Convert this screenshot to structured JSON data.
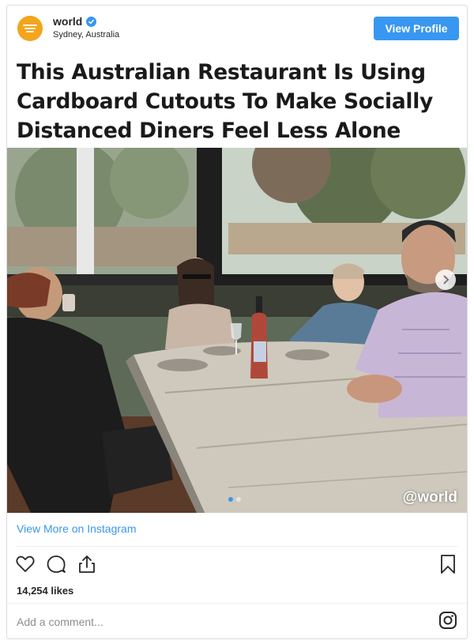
{
  "header": {
    "username": "world",
    "location": "Sydney, Australia",
    "view_profile_label": "View Profile",
    "avatar_icon": "brand-logo-icon",
    "verified_icon": "verified-badge-icon"
  },
  "post": {
    "headline": "This Australian Restaurant Is Using Cardboard Cutouts To Make Socially Distanced Diners Feel Less Alone",
    "watermark": "@world",
    "carousel": {
      "count": 2,
      "active": 1
    }
  },
  "footer": {
    "view_more_label": "View More on Instagram",
    "likes": "14,254 likes",
    "comment_placeholder": "Add a comment...",
    "icons": [
      "heart-icon",
      "comment-icon",
      "share-icon",
      "bookmark-icon",
      "instagram-icon"
    ]
  },
  "colors": {
    "accent": "#3897f0",
    "avatar": "#f2a51d",
    "text": "#262626",
    "muted": "#8e8e8e",
    "border": "#dbdbdb"
  }
}
